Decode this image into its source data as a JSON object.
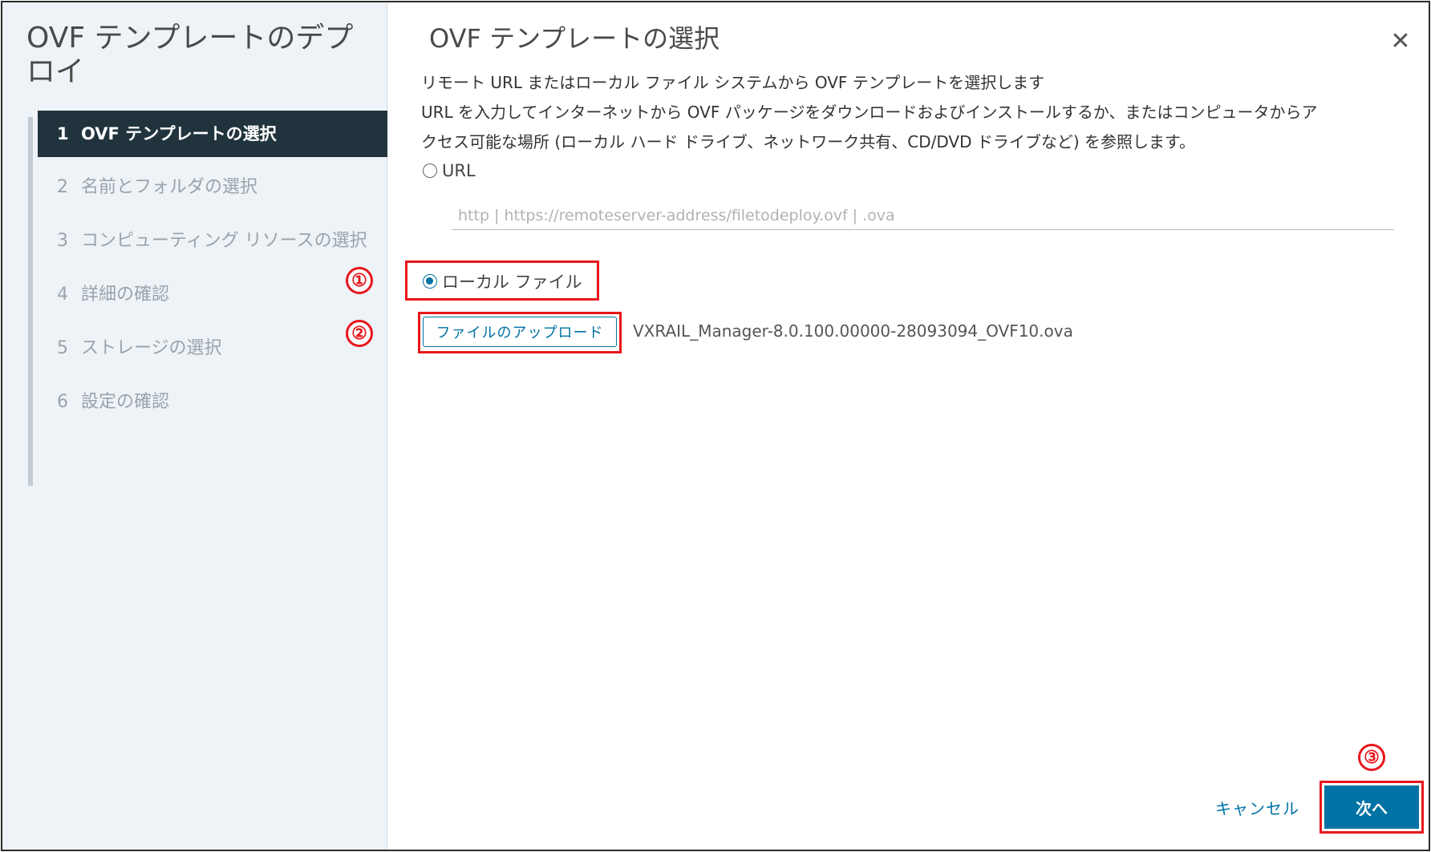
{
  "wizard": {
    "title": "OVF テンプレートのデプロイ"
  },
  "steps": [
    {
      "num": "1",
      "label": "OVF テンプレートの選択",
      "active": true
    },
    {
      "num": "2",
      "label": "名前とフォルダの選択"
    },
    {
      "num": "3",
      "label": "コンピューティング リソースの選択"
    },
    {
      "num": "4",
      "label": "詳細の確認"
    },
    {
      "num": "5",
      "label": "ストレージの選択"
    },
    {
      "num": "6",
      "label": "設定の確認"
    }
  ],
  "main": {
    "title": "OVF テンプレートの選択",
    "close_icon": "close-icon",
    "description_line1": "リモート URL またはローカル ファイル システムから OVF テンプレートを選択します",
    "description_line2": "URL を入力してインターネットから OVF パッケージをダウンロードおよびインストールするか、またはコンピュータからア",
    "description_line3": "クセス可能な場所 (ローカル ハード ドライブ、ネットワーク共有、CD/DVD ドライブなど) を参照します。",
    "url_option_label": "URL",
    "url_placeholder": "http | https://remoteserver-address/filetodeploy.ovf | .ova",
    "local_option_label": "ローカル ファイル",
    "upload_button": "ファイルのアップロード",
    "file_name": "VXRAIL_Manager-8.0.100.00000-28093094_OVF10.ova"
  },
  "callouts": {
    "one": "①",
    "two": "②",
    "three": "③"
  },
  "footer": {
    "cancel_label": "キャンセル",
    "next_label": "次へ"
  },
  "colors": {
    "accent": "#0072a3",
    "sidebar_active": "#21343d",
    "highlight": "#e8161c"
  }
}
